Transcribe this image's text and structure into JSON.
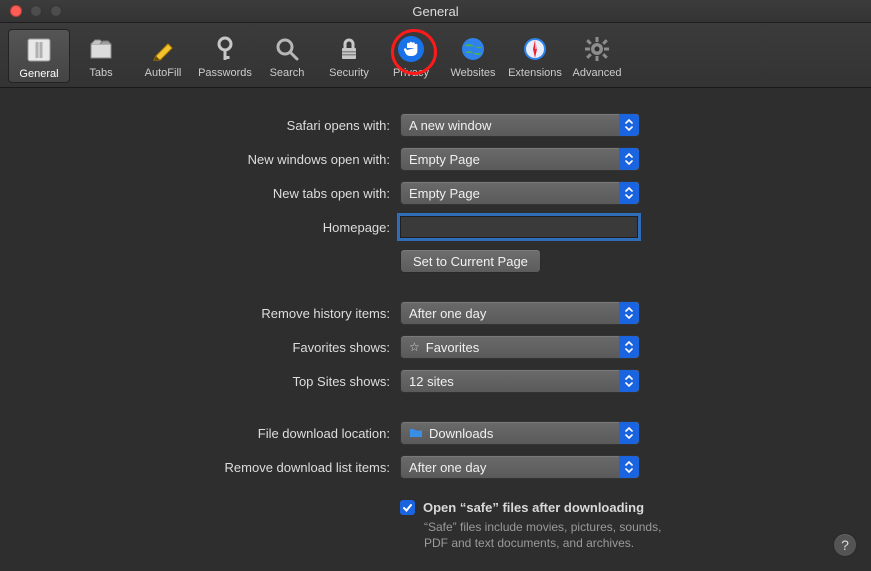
{
  "window": {
    "title": "General"
  },
  "toolbar": {
    "items": [
      {
        "id": "general",
        "label": "General"
      },
      {
        "id": "tabs",
        "label": "Tabs"
      },
      {
        "id": "autofill",
        "label": "AutoFill"
      },
      {
        "id": "passwords",
        "label": "Passwords"
      },
      {
        "id": "search",
        "label": "Search"
      },
      {
        "id": "security",
        "label": "Security"
      },
      {
        "id": "privacy",
        "label": "Privacy"
      },
      {
        "id": "websites",
        "label": "Websites"
      },
      {
        "id": "extensions",
        "label": "Extensions"
      },
      {
        "id": "advanced",
        "label": "Advanced"
      }
    ],
    "selected": "general",
    "highlighted": "privacy"
  },
  "labels": {
    "opens_with": "Safari opens with:",
    "new_windows": "New windows open with:",
    "new_tabs": "New tabs open with:",
    "homepage": "Homepage:",
    "set_current": "Set to Current Page",
    "remove_history": "Remove history items:",
    "favorites_shows": "Favorites shows:",
    "topsites_shows": "Top Sites shows:",
    "download_location": "File download location:",
    "remove_downloads": "Remove download list items:",
    "open_safe": "Open “safe” files after downloading",
    "safe_desc": "“Safe” files include movies, pictures, sounds, PDF and text documents, and archives."
  },
  "values": {
    "opens_with": "A new window",
    "new_windows": "Empty Page",
    "new_tabs": "Empty Page",
    "homepage": "",
    "remove_history": "After one day",
    "favorites_shows": "Favorites",
    "topsites_shows": "12 sites",
    "download_location": "Downloads",
    "remove_downloads": "After one day",
    "open_safe_checked": true
  },
  "help": "?"
}
